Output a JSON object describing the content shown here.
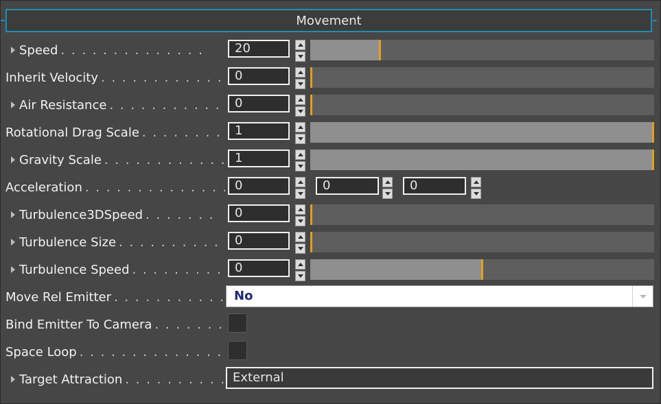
{
  "panel": {
    "title": "Movement"
  },
  "rows": {
    "speed": {
      "label": "Speed",
      "value": "20",
      "slider": 0.2
    },
    "inherit_velocity": {
      "label": "Inherit Velocity",
      "value": "0",
      "slider": 0.0
    },
    "air_resistance": {
      "label": "Air Resistance",
      "value": "0",
      "slider": 0.0
    },
    "rotational_drag_scale": {
      "label": "Rotational Drag Scale",
      "value": "1",
      "slider": 1.0
    },
    "gravity_scale": {
      "label": "Gravity Scale",
      "value": "1",
      "slider": 1.0
    },
    "acceleration": {
      "label": "Acceleration",
      "x": "0",
      "y": "0",
      "z": "0"
    },
    "turbulence_3d_speed": {
      "label": "Turbulence3DSpeed",
      "value": "0",
      "slider": 0.0
    },
    "turbulence_size": {
      "label": "Turbulence Size",
      "value": "0",
      "slider": 0.0
    },
    "turbulence_speed": {
      "label": "Turbulence Speed",
      "value": "0",
      "slider": 0.5
    },
    "move_rel_emitter": {
      "label": "Move Rel Emitter",
      "value": "No"
    },
    "bind_emitter_to_camera": {
      "label": "Bind Emitter To Camera",
      "checked": false
    },
    "space_loop": {
      "label": "Space Loop",
      "checked": false
    },
    "target_attraction": {
      "label": "Target Attraction",
      "value": "External"
    }
  },
  "colors": {
    "accent": "#1f8fb0",
    "slider_thumb": "#e0a020",
    "select_text": "#1c2a78"
  }
}
